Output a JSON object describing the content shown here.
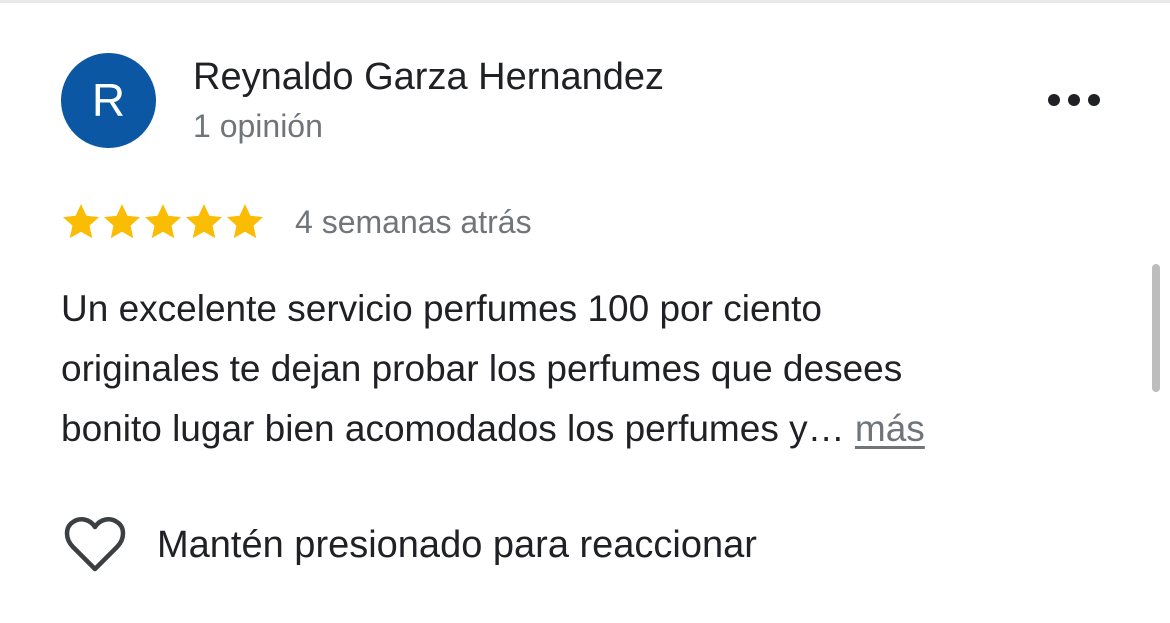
{
  "colors": {
    "avatar_bg": "#0b57a4",
    "star": "#fbbc04",
    "text_primary": "#202124",
    "text_secondary": "#70757a"
  },
  "reviewer": {
    "avatar_letter": "R",
    "name": "Reynaldo Garza Hernandez",
    "review_count": "1 opinión"
  },
  "menu": {
    "icon": "more-horiz-icon"
  },
  "review": {
    "rating": 5,
    "max_rating": 5,
    "date": "4 semanas atrás",
    "text_lines": [
      "Un excelente servicio perfumes 100 por ciento",
      "originales te dejan probar los perfumes que desees",
      "bonito lugar bien acomodados los perfumes y… "
    ],
    "more_label": "más"
  },
  "reaction": {
    "icon": "heart-outline-icon",
    "label": "Mantén presionado para reaccionar"
  }
}
